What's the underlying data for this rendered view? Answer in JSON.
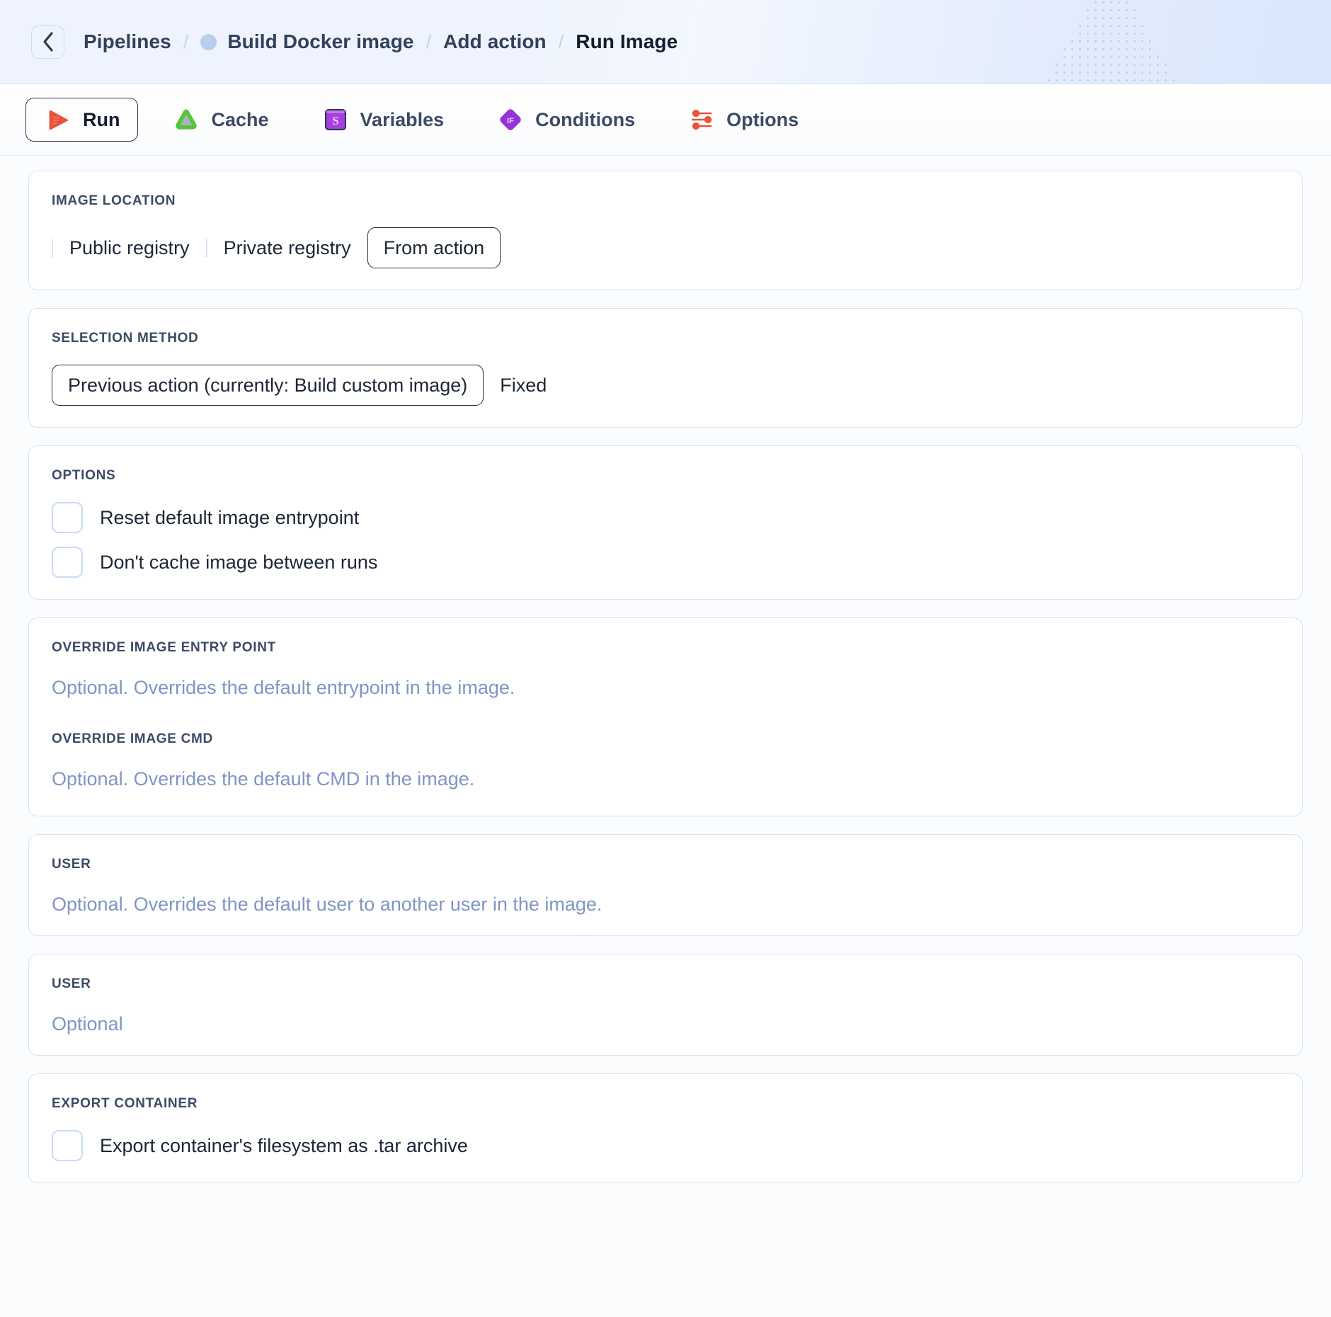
{
  "header": {
    "back_icon": "chevron-left-icon",
    "breadcrumb": {
      "pipelines": "Pipelines",
      "sep": "/",
      "pipeline_name": "Build Docker image",
      "add_action": "Add action",
      "current": "Run Image"
    }
  },
  "tabs": [
    {
      "label": "Run",
      "icon": "play-icon",
      "active": true
    },
    {
      "label": "Cache",
      "icon": "cache-triangle-icon",
      "active": false
    },
    {
      "label": "Variables",
      "icon": "variables-dollar-icon",
      "active": false
    },
    {
      "label": "Conditions",
      "icon": "conditions-if-icon",
      "active": false
    },
    {
      "label": "Options",
      "icon": "sliders-icon",
      "active": false
    }
  ],
  "sections": {
    "image_location": {
      "title": "IMAGE LOCATION",
      "choices": [
        {
          "label": "Public registry",
          "selected": false
        },
        {
          "label": "Private registry",
          "selected": false
        },
        {
          "label": "From action",
          "selected": true
        }
      ]
    },
    "selection_method": {
      "title": "SELECTION METHOD",
      "choices": [
        {
          "label": "Previous action (currently: Build custom image)",
          "selected": true
        },
        {
          "label": "Fixed",
          "selected": false
        }
      ]
    },
    "options": {
      "title": "OPTIONS",
      "checkboxes": [
        {
          "label": "Reset default image entrypoint",
          "checked": false
        },
        {
          "label": "Don't cache image between runs",
          "checked": false
        }
      ]
    },
    "override_entrypoint": {
      "title": "OVERRIDE IMAGE ENTRY POINT",
      "placeholder": "Optional. Overrides the default entrypoint in the image.",
      "value": ""
    },
    "override_cmd": {
      "title": "OVERRIDE IMAGE CMD",
      "placeholder": "Optional. Overrides the default CMD in the image.",
      "value": ""
    },
    "user_override": {
      "title": "USER",
      "placeholder": "Optional. Overrides the default user to another user in the image.",
      "value": ""
    },
    "user_simple": {
      "title": "USER",
      "placeholder": "Optional",
      "value": ""
    },
    "export_container": {
      "title": "EXPORT CONTAINER",
      "checkboxes": [
        {
          "label": "Export container's filesystem as .tar archive",
          "checked": false
        }
      ]
    }
  },
  "colors": {
    "accent_orange": "#e8533a",
    "cache_green": "#57c43a",
    "variables_purple": "#a73ee0",
    "conditions_purple": "#9633d6",
    "border_blue": "#d6e3f7",
    "text_dark": "#1d2637",
    "placeholder": "#8095c4"
  }
}
